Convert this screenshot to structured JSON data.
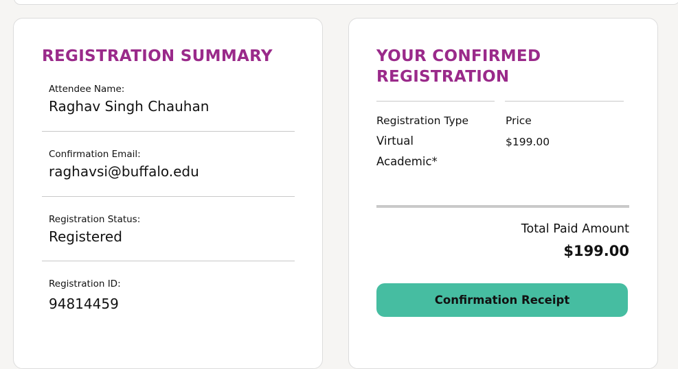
{
  "summary": {
    "title": "REGISTRATION SUMMARY",
    "fields": [
      {
        "label": "Attendee Name:",
        "value": "Raghav Singh Chauhan"
      },
      {
        "label": "Confirmation Email:",
        "value": "raghavsi@buffalo.edu"
      },
      {
        "label": "Registration Status:",
        "value": "Registered"
      },
      {
        "label": "Registration ID:",
        "value": "94814459"
      }
    ]
  },
  "confirmed": {
    "title_line1": "YOUR CONFIRMED",
    "title_line2": "REGISTRATION",
    "columns": {
      "type_header": "Registration Type",
      "price_header": "Price"
    },
    "row": {
      "type_line1": "Virtual",
      "type_line2": "Academic*",
      "price": "$199.00"
    },
    "total_label": "Total Paid Amount",
    "total_amount": "$199.00",
    "receipt_button_label": "Confirmation Receipt"
  },
  "colors": {
    "accent_title": "#9a2a8a",
    "button": "#46bda1",
    "background": "#f6f5f3"
  }
}
